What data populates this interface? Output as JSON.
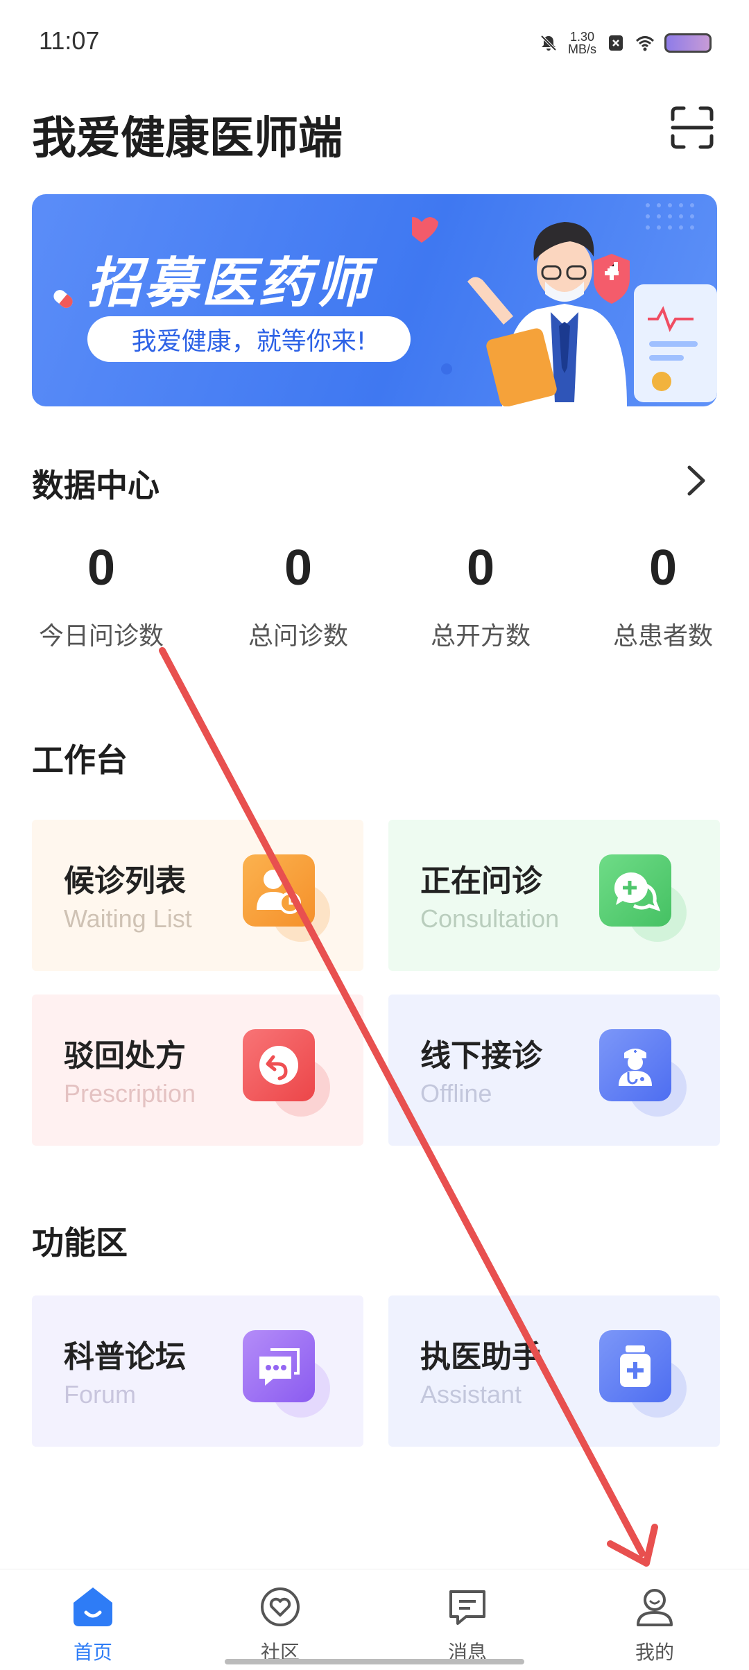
{
  "status_bar": {
    "time": "11:07",
    "speed_value": "1.30",
    "speed_unit": "MB/s"
  },
  "header": {
    "title": "我爱健康医师端",
    "scan_icon": "scan-icon"
  },
  "banner": {
    "title": "招募医药师",
    "slogan": "我爱健康，就等你来!"
  },
  "data_center": {
    "title": "数据中心",
    "stats": [
      {
        "value": "0",
        "label": "今日问诊数"
      },
      {
        "value": "0",
        "label": "总问诊数"
      },
      {
        "value": "0",
        "label": "总开方数"
      },
      {
        "value": "0",
        "label": "总患者数"
      }
    ]
  },
  "workbench": {
    "title": "工作台",
    "cards": [
      {
        "title": "候诊列表",
        "subtitle": "Waiting List",
        "icon": "waiting-list-icon",
        "bg": "#fff7ee",
        "sub_color": "#cfc2b4",
        "icon_color": "#f9a23c"
      },
      {
        "title": "正在问诊",
        "subtitle": "Consultation",
        "icon": "consultation-icon",
        "bg": "#eefbf1",
        "sub_color": "#b9cdbd",
        "icon_color": "#58cf73"
      },
      {
        "title": "驳回处方",
        "subtitle": "Prescription",
        "icon": "reject-icon",
        "bg": "#fff1f1",
        "sub_color": "#e4c2c2",
        "icon_color": "#f05557"
      },
      {
        "title": "线下接诊",
        "subtitle": "Offline",
        "icon": "doctor-icon",
        "bg": "#eff2fe",
        "sub_color": "#c3c7dc",
        "icon_color": "#5b7cf4"
      }
    ]
  },
  "functions": {
    "title": "功能区",
    "cards": [
      {
        "title": "科普论坛",
        "subtitle": "Forum",
        "icon": "forum-icon",
        "bg": "#f3f2fe",
        "sub_color": "#c8c5dd",
        "icon_color": "#9a6cf3"
      },
      {
        "title": "执医助手",
        "subtitle": "Assistant",
        "icon": "medicine-icon",
        "bg": "#eff2fe",
        "sub_color": "#c3c7dc",
        "icon_color": "#5b7cf4"
      }
    ]
  },
  "bottom_nav": {
    "items": [
      {
        "label": "首页",
        "icon": "home-icon",
        "active": true
      },
      {
        "label": "社区",
        "icon": "community-icon",
        "active": false
      },
      {
        "label": "消息",
        "icon": "message-icon",
        "active": false
      },
      {
        "label": "我的",
        "icon": "profile-icon",
        "active": false
      }
    ],
    "active_color": "#2e7cf6"
  },
  "annotation": {
    "color": "#e8504f"
  }
}
